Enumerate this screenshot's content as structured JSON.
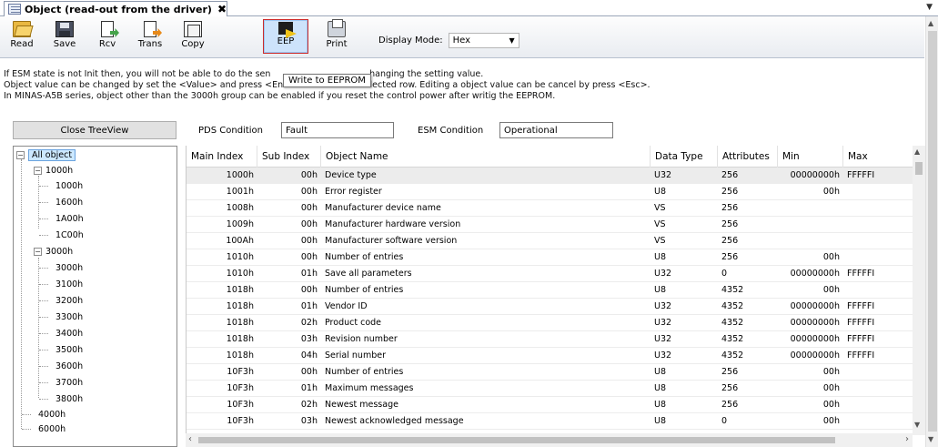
{
  "tab": {
    "title": "Object (read-out from the driver)",
    "close": "✖"
  },
  "toolbar": {
    "read": "Read",
    "save": "Save",
    "rcv": "Rcv",
    "trans": "Trans",
    "copy": "Copy",
    "eep": "EEP",
    "print": "Print",
    "display_mode_label": "Display Mode:",
    "display_mode_value": "Hex"
  },
  "tooltip": "Write to EEPROM",
  "info": {
    "line1": "If ESM state is not Init then, you will not be able to do the sen                                    hanging the setting value.",
    "line2": "Object value can be changed by set the <Value> and press <Enter> or leave the selected row. Editing a object value can be cancel by press <Esc>.",
    "line3": "In MINAS-A5B series, object other than the 3000h group can be enabled if you reset the control power after writig the EEPROM."
  },
  "close_treeview": "Close TreeView",
  "pds_condition": {
    "label": "PDS Condition",
    "value": "Fault"
  },
  "esm_condition": {
    "label": "ESM Condition",
    "value": "Operational"
  },
  "tree": {
    "root": "All object",
    "groups": [
      {
        "label": "1000h",
        "children": [
          "1000h",
          "1600h",
          "1A00h",
          "1C00h"
        ]
      },
      {
        "label": "3000h",
        "children": [
          "3000h",
          "3100h",
          "3200h",
          "3300h",
          "3400h",
          "3500h",
          "3600h",
          "3700h",
          "3800h"
        ]
      }
    ],
    "leaves": [
      "4000h",
      "6000h"
    ]
  },
  "grid": {
    "headers": [
      "Main Index",
      "Sub Index",
      "Object Name",
      "Data Type",
      "Attributes",
      "Min",
      "Max"
    ],
    "rows": [
      [
        "1000h",
        "00h",
        "Device type",
        "U32",
        "256",
        "00000000h",
        "FFFFFI"
      ],
      [
        "1001h",
        "00h",
        "Error register",
        "U8",
        "256",
        "00h",
        ""
      ],
      [
        "1008h",
        "00h",
        "Manufacturer device name",
        "VS",
        "256",
        "",
        ""
      ],
      [
        "1009h",
        "00h",
        "Manufacturer hardware version",
        "VS",
        "256",
        "",
        ""
      ],
      [
        "100Ah",
        "00h",
        "Manufacturer software version",
        "VS",
        "256",
        "",
        ""
      ],
      [
        "1010h",
        "00h",
        "Number of entries",
        "U8",
        "256",
        "00h",
        ""
      ],
      [
        "1010h",
        "01h",
        "Save all parameters",
        "U32",
        "0",
        "00000000h",
        "FFFFFI"
      ],
      [
        "1018h",
        "00h",
        "Number of entries",
        "U8",
        "4352",
        "00h",
        ""
      ],
      [
        "1018h",
        "01h",
        "Vendor ID",
        "U32",
        "4352",
        "00000000h",
        "FFFFFI"
      ],
      [
        "1018h",
        "02h",
        "Product code",
        "U32",
        "4352",
        "00000000h",
        "FFFFFI"
      ],
      [
        "1018h",
        "03h",
        "Revision number",
        "U32",
        "4352",
        "00000000h",
        "FFFFFI"
      ],
      [
        "1018h",
        "04h",
        "Serial number",
        "U32",
        "4352",
        "00000000h",
        "FFFFFI"
      ],
      [
        "10F3h",
        "00h",
        "Number of entries",
        "U8",
        "256",
        "00h",
        ""
      ],
      [
        "10F3h",
        "01h",
        "Maximum messages",
        "U8",
        "256",
        "00h",
        ""
      ],
      [
        "10F3h",
        "02h",
        "Newest message",
        "U8",
        "256",
        "00h",
        ""
      ],
      [
        "10F3h",
        "03h",
        "Newest acknowledged message",
        "U8",
        "0",
        "00h",
        ""
      ]
    ]
  }
}
